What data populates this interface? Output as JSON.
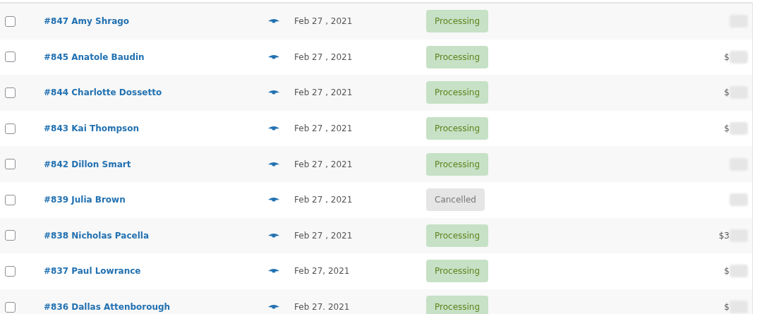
{
  "orders": [
    {
      "checked": false,
      "order": "#847 Amy Shrago",
      "date": "Feb 27 , 2021",
      "status": {
        "kind": "processing",
        "label": "Processing"
      }
    },
    {
      "checked": false,
      "order": "#845 Anatole Baudin",
      "date": "Feb 27 , 2021",
      "status": {
        "kind": "processing",
        "label": "Processing"
      },
      "total": "$"
    },
    {
      "checked": false,
      "order": "#844 Charlotte Dossetto",
      "date": "Feb 27 , 2021",
      "status": {
        "kind": "processing",
        "label": "Processing"
      },
      "total": "$"
    },
    {
      "checked": false,
      "order": "#843 Kai Thompson",
      "date": "Feb 27 , 2021",
      "status": {
        "kind": "processing",
        "label": "Processing"
      },
      "total": "$"
    },
    {
      "checked": false,
      "order": "#842 Dillon Smart",
      "date": "Feb 27 , 2021",
      "status": {
        "kind": "processing",
        "label": "Processing"
      }
    },
    {
      "checked": false,
      "order": "#839 Julia Brown",
      "date": "Feb 27 , 2021",
      "status": {
        "kind": "cancelled",
        "label": "Cancelled"
      }
    },
    {
      "checked": false,
      "order": "#838 Nicholas Pacella",
      "date": "Feb 27 , 2021",
      "status": {
        "kind": "processing",
        "label": "Processing"
      },
      "total": "$3"
    },
    {
      "checked": false,
      "order": "#837 Paul Lowrance",
      "date": "Feb 27, 2021",
      "status": {
        "kind": "processing",
        "label": "Processing"
      },
      "total": "$"
    },
    {
      "checked": false,
      "order": "#836 Dallas Attenborough",
      "date": "Feb 27. 2021",
      "status": {
        "kind": "processing",
        "label": "Processing"
      },
      "total": "$"
    }
  ]
}
